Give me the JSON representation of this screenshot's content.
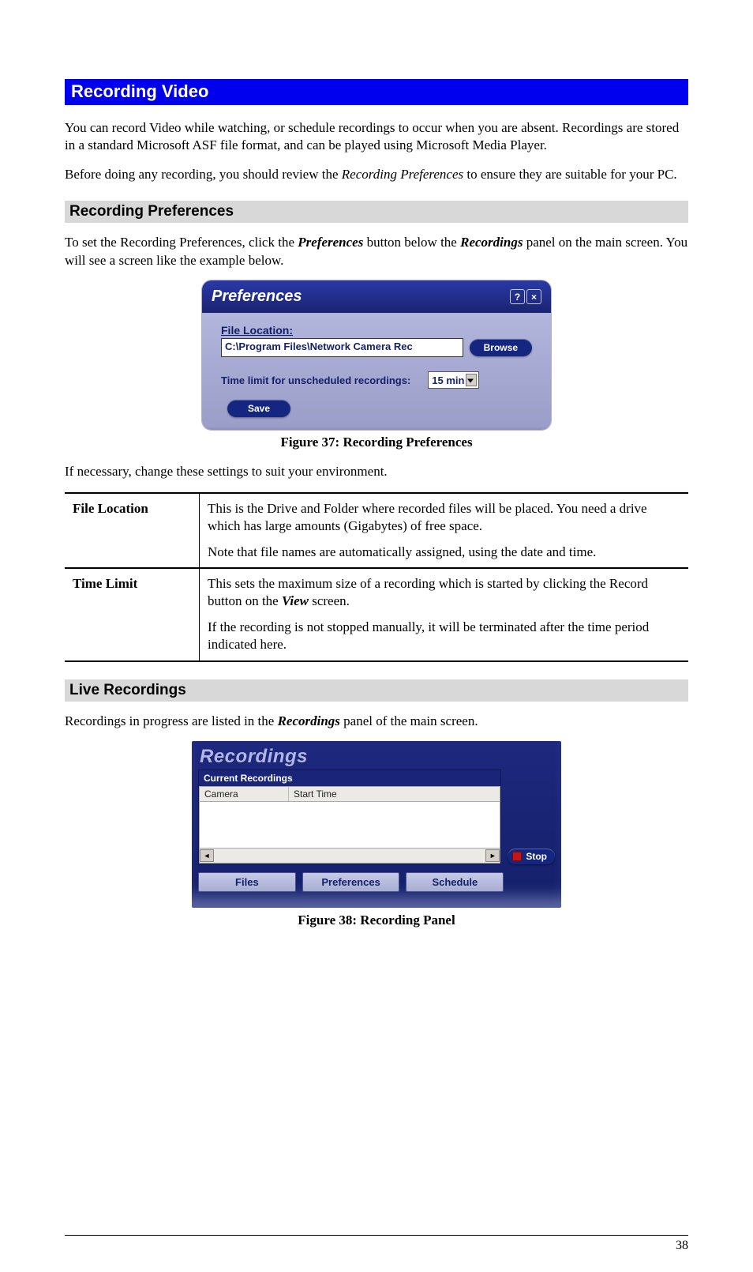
{
  "page_number": "38",
  "heading_main": "Recording Video",
  "intro_p1": "You can record Video while watching, or schedule recordings to occur when you are absent. Recordings are stored in a standard Microsoft ASF file format, and can be played using Microsoft Media Player.",
  "intro_p2_a": "Before doing any recording, you should review the ",
  "intro_p2_em": "Recording Preferences",
  "intro_p2_b": " to ensure they are suitable for your PC.",
  "heading_prefs": "Recording Preferences",
  "prefs_intro_a": "To set the Recording Preferences, click the ",
  "prefs_intro_em1": "Preferences",
  "prefs_intro_b": " button below the ",
  "prefs_intro_em2": "Recordings",
  "prefs_intro_c": " panel on the main screen. You will see a screen like the example below.",
  "prefs_dialog": {
    "title": "Preferences",
    "help_glyph": "?",
    "close_glyph": "×",
    "file_location_label": "File Location:",
    "file_location_value": "C:\\Program Files\\Network Camera Rec",
    "browse": "Browse",
    "time_limit_label": "Time limit for unscheduled recordings:",
    "time_limit_value": "15 min",
    "save": "Save"
  },
  "figure37_caption": "Figure 37: Recording Preferences",
  "prefs_outro": "If necessary, change these settings to suit your environment.",
  "table": {
    "row1_label": "File Location",
    "row1_p1": "This is the Drive and Folder where recorded files will be placed. You need a drive which has large amounts (Gigabytes) of free space.",
    "row1_p2": "Note that file names are automatically assigned, using the date and time.",
    "row2_label": "Time Limit",
    "row2_p1_a": "This sets the maximum size of a recording which is started by clicking the Record button on the ",
    "row2_p1_em": "View",
    "row2_p1_b": " screen.",
    "row2_p2": "If the recording is not stopped manually, it will be terminated after the time period indicated here."
  },
  "heading_live": "Live Recordings",
  "live_intro_a": "Recordings in progress are listed in the ",
  "live_intro_em": "Recordings",
  "live_intro_b": " panel of the main screen.",
  "rec_panel": {
    "title": "Recordings",
    "subtitle": "Current Recordings",
    "col_camera": "Camera",
    "col_start": "Start Time",
    "scroll_left": "◄",
    "scroll_right": "►",
    "stop": "Stop",
    "btn_files": "Files",
    "btn_prefs": "Preferences",
    "btn_sched": "Schedule"
  },
  "figure38_caption": "Figure 38: Recording Panel"
}
